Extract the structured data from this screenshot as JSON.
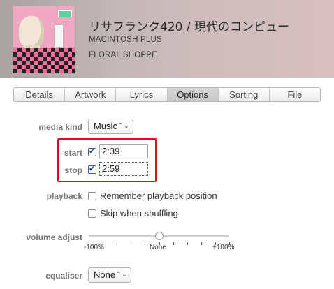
{
  "track": {
    "title": "リサフランク420 / 現代のコンピュー",
    "artist": "MACINTOSH PLUS",
    "album": "FLORAL SHOPPE",
    "artwork_icon": "album-artwork"
  },
  "tabs": [
    {
      "label": "Details",
      "active": false
    },
    {
      "label": "Artwork",
      "active": false
    },
    {
      "label": "Lyrics",
      "active": false
    },
    {
      "label": "Options",
      "active": true
    },
    {
      "label": "Sorting",
      "active": false
    },
    {
      "label": "File",
      "active": false
    }
  ],
  "options": {
    "media_kind": {
      "label": "media kind",
      "value": "Music"
    },
    "start": {
      "label": "start",
      "checked": true,
      "value": "2:39"
    },
    "stop": {
      "label": "stop",
      "checked": true,
      "value": "2:59"
    },
    "playback": {
      "label": "playback",
      "remember": {
        "text": "Remember playback position",
        "checked": false
      },
      "skip": {
        "text": "Skip when shuffling",
        "checked": false
      }
    },
    "volume_adjust": {
      "label": "volume adjust",
      "level_percent": 0,
      "min_label": "-100%",
      "mid_label": "None",
      "max_label": "+100%"
    },
    "equaliser": {
      "label": "equaliser",
      "value": "None"
    }
  },
  "colors": {
    "highlight": "#e00d1d",
    "active_tab": "#cccccc"
  }
}
